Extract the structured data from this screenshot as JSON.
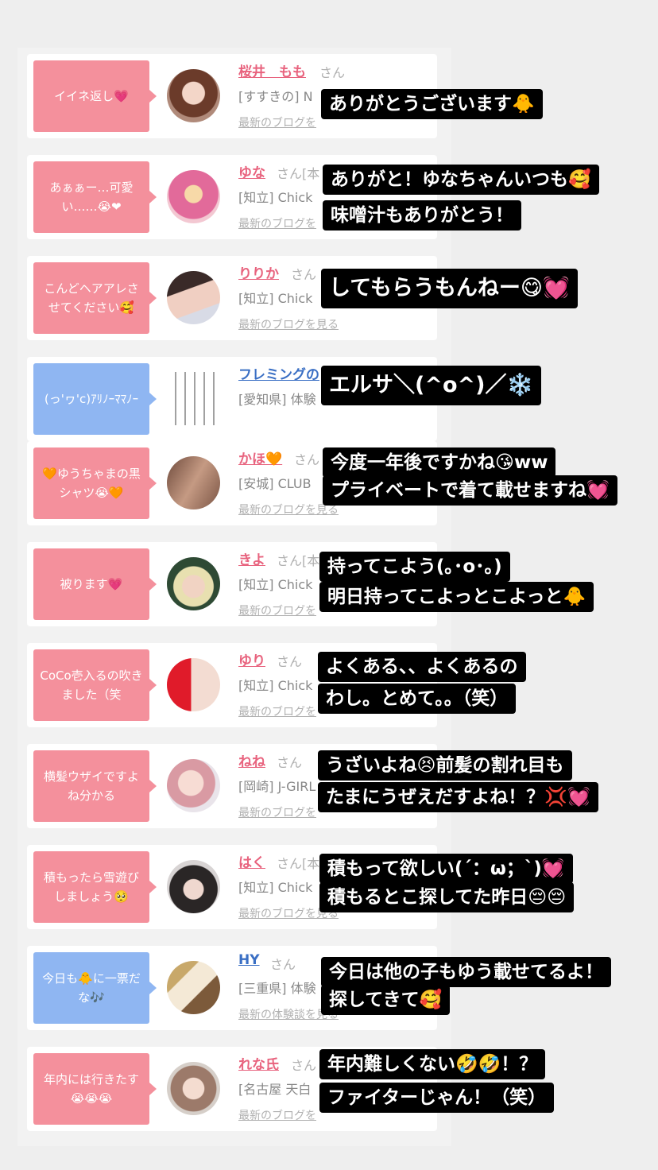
{
  "colors": {
    "pink": "#f4909c",
    "blue": "#8fb6f2",
    "name_pink": "#e8637e",
    "name_blue": "#3a6fc4",
    "caption_bg": "#000000"
  },
  "cards": [
    {
      "bubble": "イイネ返し💗",
      "bubble_color": "pink",
      "name": "桜井　もも",
      "san": "さん",
      "shop": "[すすきの] N",
      "link": "最新のブログを",
      "avatar_desc": "woman-photo"
    },
    {
      "bubble": "あぁぁー…可愛い……😭❤",
      "bubble_color": "pink",
      "name": "ゆな",
      "san": "さん[本",
      "shop": "[知立] Chick",
      "link": "最新のブログを",
      "avatar_desc": "pink-hair-photo"
    },
    {
      "bubble": "こんどヘアアレさせてください🥰",
      "bubble_color": "pink",
      "name": "りりか",
      "san": "さん",
      "shop": "[知立] Chick",
      "link": "最新のブログを見る",
      "avatar_desc": "woman-photo"
    },
    {
      "bubble": "(っ'ヮ'c)ｱﾘﾉｰﾏﾏﾉｰ",
      "bubble_color": "blue",
      "name": "フレミングの",
      "san": "",
      "shop": "[愛知県] 体験",
      "link": "",
      "avatar_desc": "sketch-icons"
    },
    {
      "bubble": "🧡ゆうちゃまの黒シャツ😭🧡",
      "bubble_color": "pink",
      "name": "かほ🧡",
      "san": "さん",
      "shop": "[安城] CLUB",
      "link": "最新のブログを見る",
      "avatar_desc": "hair-photo"
    },
    {
      "bubble": "被ります💗",
      "bubble_color": "pink",
      "name": "きよ",
      "san": "さん[本",
      "shop": "[知立] Chick",
      "link": "最新のブログを",
      "avatar_desc": "woman-photo"
    },
    {
      "bubble": "CoCo壱入るの吹きました（笑",
      "bubble_color": "pink",
      "name": "ゆり",
      "san": "さん",
      "shop": "[知立] Chick",
      "link": "最新のブログを",
      "avatar_desc": "heart-photo"
    },
    {
      "bubble": "横髪ウザイですよね分かる",
      "bubble_color": "pink",
      "name": "ねね",
      "san": "さん",
      "shop": "[岡崎] J-GIRL",
      "link": "最新のブログを",
      "avatar_desc": "woman-photo"
    },
    {
      "bubble": "積もったら雪遊びしましょう🥺",
      "bubble_color": "pink",
      "name": "はく",
      "san": "さん[本",
      "shop": "[知立] Chick",
      "link": "最新のブログを見る",
      "avatar_desc": "woman-photo"
    },
    {
      "bubble": "今日も🐥に一票だな🎶",
      "bubble_color": "blue",
      "name": "HY",
      "san": "さん",
      "shop": "[三重県] 体験",
      "link": "最新の体験談を見る",
      "avatar_desc": "room-photo"
    },
    {
      "bubble": "年内には行きたす😭😭😭",
      "bubble_color": "pink",
      "name": "れな氏",
      "san": "さん",
      "shop": "[名古屋 天白",
      "link": "最新のブログを",
      "avatar_desc": "woman-photo"
    }
  ],
  "captions": [
    {
      "lines": [
        "ありがとうございます🐥"
      ]
    },
    {
      "lines": [
        "ありがと！ゆなちゃんいつも🥰",
        "味噌汁もありがとう！"
      ]
    },
    {
      "lines": [
        "してもらうもんねー😋💓"
      ]
    },
    {
      "lines": [
        "エルサ＼(^o^)／❄️"
      ]
    },
    {
      "lines": [
        "今度一年後ですかね😘ww",
        "プライベートで着て載せますね💓"
      ]
    },
    {
      "lines": [
        "持ってこよう(｡･o･｡)",
        "明日持ってこよっとこよっと🐥"
      ]
    },
    {
      "lines": [
        "よくある、、よくあるの",
        "わし。とめて。。（笑）"
      ]
    },
    {
      "lines": [
        "うざいよね😣前髪の割れ目も",
        "たまにうぜえだすよね！？💢💓"
      ]
    },
    {
      "lines": [
        "積もって欲しい(´：ω；`)💓",
        "積もるとこ探してた昨日😔😔"
      ]
    },
    {
      "lines": [
        "今日は他の子もゆう載せてるよ！",
        "探してきて🥰"
      ]
    },
    {
      "lines": [
        "年内難しくない🤣🤣！？",
        "ファイターじゃん！（笑）"
      ]
    }
  ]
}
